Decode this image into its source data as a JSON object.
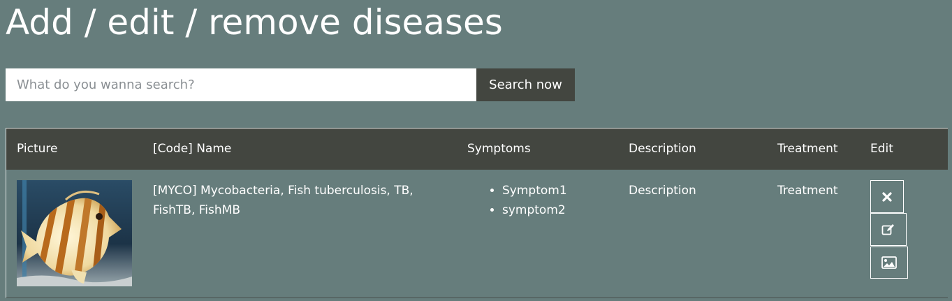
{
  "page": {
    "title": "Add / edit / remove diseases"
  },
  "search": {
    "placeholder": "What do you wanna search?",
    "button_label": "Search now"
  },
  "table": {
    "headers": [
      "Picture",
      "[Code] Name",
      "Symptoms",
      "Description",
      "Treatment",
      "Edit"
    ],
    "rows": [
      {
        "picture": "fish-image",
        "name": "[MYCO] Mycobacteria, Fish tuberculosis, TB, FishTB, FishMB",
        "symptoms": [
          "Symptom1",
          "symptom2"
        ],
        "description": "Description",
        "treatment": "Treatment",
        "actions": [
          "delete-icon",
          "edit-icon",
          "image-icon"
        ]
      }
    ]
  },
  "colors": {
    "background": "#667d7c",
    "header": "#434640",
    "button": "#434640",
    "text": "#ffffff"
  }
}
